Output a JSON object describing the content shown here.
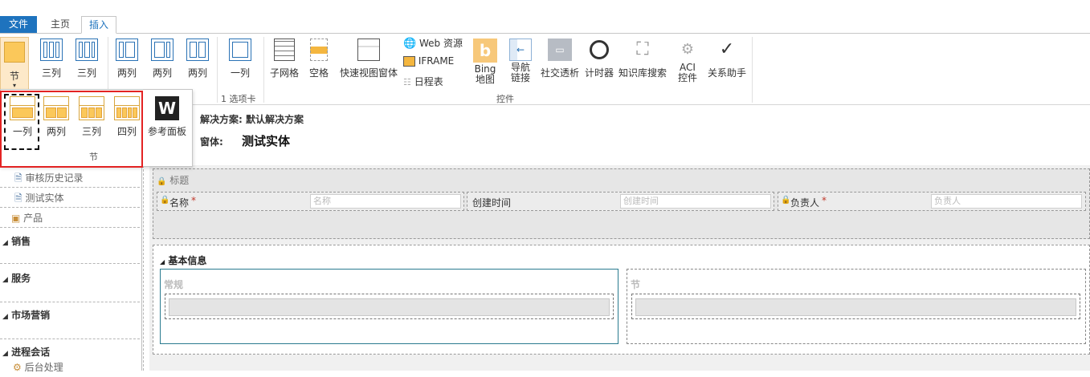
{
  "tabs": {
    "file": "文件",
    "home": "主页",
    "insert": "插入"
  },
  "ribbon": {
    "section_button": "节",
    "layout_buttons": [
      "三列",
      "三列",
      "两列",
      "两列",
      "两列",
      "一列"
    ],
    "tab_group_label": "1 选项卡",
    "controls": {
      "subgrid": "子网格",
      "spacer": "空格",
      "quick_view": "快速视图窗体",
      "web_resource": "Web 资源",
      "iframe": "IFRAME",
      "timeline": "日程表",
      "bing_map_1": "Bing",
      "bing_map_2": "地图",
      "nav_link_1": "导航",
      "nav_link_2": "链接",
      "social_pane": "社交透析",
      "timer": "计时器",
      "kb_search": "知识库搜索",
      "aci_1": "ACI",
      "aci_2": "控件",
      "relationship_assistant": "关系助手"
    },
    "controls_group_label": "控件"
  },
  "dropdown": {
    "items": [
      "一列",
      "两列",
      "三列",
      "四列"
    ],
    "reference_panel": "参考面板",
    "group_label": "节"
  },
  "header": {
    "solution": "解决方案: 默认解决方案",
    "form_label": "窗体:",
    "form_name": "测试实体"
  },
  "nav": {
    "items_top": [
      "审核历史记录",
      "测试实体",
      "产品"
    ],
    "groups": [
      "销售",
      "服务",
      "市场营销",
      "进程会话"
    ],
    "item_bottom": "后台处理"
  },
  "form": {
    "header_label": "标题",
    "fields": [
      {
        "label": "名称",
        "placeholder": "名称",
        "required": "*"
      },
      {
        "label": "创建时间",
        "placeholder": "创建时间",
        "required": ""
      },
      {
        "label": "负责人",
        "placeholder": "负责人",
        "required": "*"
      }
    ],
    "tab_label": "基本信息",
    "section_1": "常规",
    "section_2": "节"
  },
  "colors": {
    "accent": "#1e73be",
    "highlight_red": "#e32323",
    "section_yellow": "#fbc85a"
  }
}
